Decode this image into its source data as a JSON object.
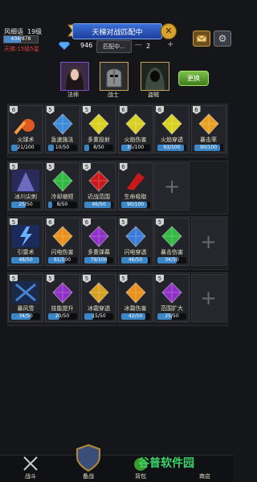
{
  "player": {
    "name": "风细语",
    "level": "19级",
    "xp_text": "434/878",
    "xp_fraction": 0.49,
    "rank": "天梯:15级5星"
  },
  "match": {
    "title": "天梯对战匹配中",
    "close": "✕",
    "gems": "946",
    "status": "匹配中...",
    "minus": "—",
    "count": "2",
    "plus": "+"
  },
  "heroes": [
    {
      "label": "法师",
      "icon": "mage-portrait-icon"
    },
    {
      "label": "战士",
      "icon": "warrior-portrait-icon"
    },
    {
      "label": "盗贼",
      "icon": "thief-portrait-icon"
    }
  ],
  "swap_label": "更换",
  "rows": [
    [
      {
        "level": "6",
        "name": "火球术",
        "progress": "21/100",
        "fraction": 0.21,
        "color": "#e05a20",
        "icon": "fireball-icon"
      },
      {
        "level": "5",
        "name": "急速施法",
        "progress": "10/50",
        "fraction": 0.2,
        "color": "#3a8ad8",
        "icon": "blue-crystal-icon"
      },
      {
        "level": "5",
        "name": "多重投射",
        "progress": "8/50",
        "fraction": 0.16,
        "color": "#d8d020",
        "icon": "yellow-crystal-icon"
      },
      {
        "level": "6",
        "name": "火焰伤害",
        "progress": "35/100",
        "fraction": 0.35,
        "color": "#d8d020",
        "icon": "yellow-crystal-icon"
      },
      {
        "level": "6",
        "name": "火焰穿透",
        "progress": "93/100",
        "fraction": 0.93,
        "color": "#d8d020",
        "icon": "yellow-crystal-icon"
      },
      {
        "level": "6",
        "name": "暴击率",
        "progress": "90/100",
        "fraction": 0.9,
        "color": "#e8a020",
        "icon": "orange-crystal-icon"
      }
    ],
    [
      {
        "level": "5",
        "name": "冰川尖刺",
        "progress": "25/50",
        "fraction": 0.5,
        "color": "#7a7ad8",
        "icon": "ice-spike-icon"
      },
      {
        "level": "5",
        "name": "冷却缩短",
        "progress": "8/50",
        "fraction": 0.16,
        "color": "#30b840",
        "icon": "green-crystal-icon"
      },
      {
        "level": "5",
        "name": "近战范围",
        "progress": "46/50",
        "fraction": 0.92,
        "color": "#c81818",
        "icon": "red-crystal-icon"
      },
      {
        "level": "6",
        "name": "生命吸取",
        "progress": "90/100",
        "fraction": 0.9,
        "color": "#c81818",
        "icon": "red-shard-icon"
      }
    ],
    [
      {
        "level": "5",
        "name": "引雷术",
        "progress": "48/50",
        "fraction": 0.96,
        "color": "#6ab0ff",
        "icon": "lightning-icon"
      },
      {
        "level": "6",
        "name": "闪电伤害",
        "progress": "61/100",
        "fraction": 0.61,
        "color": "#e8901a",
        "icon": "orange-crystal-icon"
      },
      {
        "level": "6",
        "name": "多重弹幕",
        "progress": "79/100",
        "fraction": 0.79,
        "color": "#9030c8",
        "icon": "purple-crystal-icon"
      },
      {
        "level": "5",
        "name": "闪电穿透",
        "progress": "46/50",
        "fraction": 0.92,
        "color": "#3a7ad8",
        "icon": "blue-crystal-icon"
      },
      {
        "level": "5",
        "name": "暴击伤害",
        "progress": "34/50",
        "fraction": 0.68,
        "color": "#30b840",
        "icon": "green-crystal-icon"
      }
    ],
    [
      {
        "level": "5",
        "name": "暴风雪",
        "progress": "34/50",
        "fraction": 0.68,
        "color": "#4a80d0",
        "icon": "blizzard-icon"
      },
      {
        "level": "5",
        "name": "技能提升",
        "progress": "20/50",
        "fraction": 0.4,
        "color": "#9030c8",
        "icon": "purple-crystal-icon"
      },
      {
        "level": "5",
        "name": "冰霜穿透",
        "progress": "15/50",
        "fraction": 0.3,
        "color": "#d8a020",
        "icon": "yellow-crystal-icon"
      },
      {
        "level": "5",
        "name": "冰霜伤害",
        "progress": "42/50",
        "fraction": 0.84,
        "color": "#e8901a",
        "icon": "orange-crystal-icon"
      },
      {
        "level": "5",
        "name": "范围扩大",
        "progress": "25/50",
        "fraction": 0.5,
        "color": "#9030c8",
        "icon": "purple-crystal-icon"
      }
    ]
  ],
  "nav": [
    {
      "label": "战斗",
      "icon": "crossed-swords-icon"
    },
    {
      "label": "备战",
      "icon": "shield-icon"
    },
    {
      "label": "背包",
      "icon": "bag-icon"
    },
    {
      "label": "商店",
      "icon": "shop-icon"
    }
  ],
  "watermark": "谷普软件园"
}
